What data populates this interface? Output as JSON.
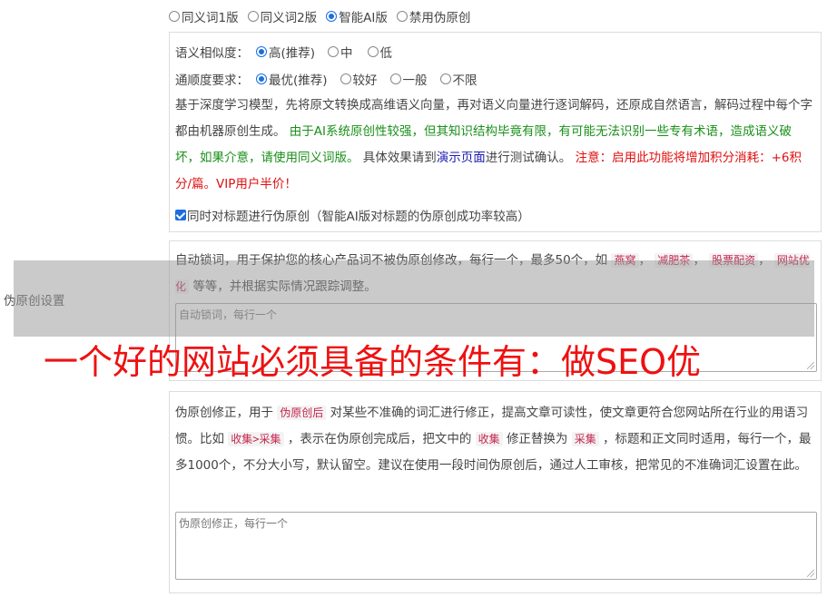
{
  "side_label": "伪原创设置",
  "modes": [
    {
      "label": "同义词1版",
      "selected": false
    },
    {
      "label": "同义词2版",
      "selected": false
    },
    {
      "label": "智能AI版",
      "selected": true
    },
    {
      "label": "禁用伪原创",
      "selected": false
    }
  ],
  "similarity": {
    "label": "语义相似度：",
    "options": [
      {
        "label": "高(推荐)",
        "selected": true
      },
      {
        "label": "中",
        "selected": false
      },
      {
        "label": "低",
        "selected": false
      }
    ]
  },
  "fluency": {
    "label": "通顺度要求：",
    "options": [
      {
        "label": "最优(推荐)",
        "selected": true
      },
      {
        "label": "较好",
        "selected": false
      },
      {
        "label": "一般",
        "selected": false
      },
      {
        "label": "不限",
        "selected": false
      }
    ]
  },
  "ai_desc": {
    "part1": "基于深度学习模型，先将原文转换成高维语义向量，再对语义向量进行逐词解码，还原成自然语言，解码过程中每个字都由机器原创生成。",
    "part2_green": "由于AI系统原创性较强，但其知识结构毕竟有限，有可能无法识别一些专有术语，造成语义破坏，如果介意，请使用同义词版。",
    "part3": "具体效果请到",
    "link_blue": "演示页面",
    "part4": "进行测试确认。",
    "part5_red": "注意：启用此功能将增加积分消耗：+6积分/篇。VIP用户半价！"
  },
  "title_checkbox": {
    "label": "同时对标题进行伪原创（智能AI版对标题的伪原创成功率较高）",
    "checked": true
  },
  "lock_words": {
    "desc_before": "自动锁词，用于保护您的核心产品词不被伪原创修改，每行一个，最多50个，如",
    "examples": [
      "燕窝",
      "减肥茶",
      "股票配资",
      "网站优化"
    ],
    "sep": "，",
    "desc_after": "等等，并根据实际情况跟踪调整。",
    "placeholder": "自动锁词，每行一个"
  },
  "corrections": {
    "t1": "伪原创修正，用于",
    "tag1": "伪原创后",
    "t2": "对某些不准确的词汇进行修正，提高文章可读性，使文章更符合您网站所在行业的用语习惯。比如",
    "tag2": "收集>采集",
    "t3": "，表示在伪原创完成后，把文中的",
    "tag3": "收集",
    "t4": "修正替换为",
    "tag4": "采集",
    "t5": "，标题和正文同时适用，每行一个，最多1000个，不分大小写，默认留空。建议在使用一段时间伪原创后，通过人工审核，把常见的不准确词汇设置在此。",
    "placeholder": "伪原创修正，每行一个"
  },
  "banner_text": "一个好的网站必须具备的条件有：做SEO优"
}
